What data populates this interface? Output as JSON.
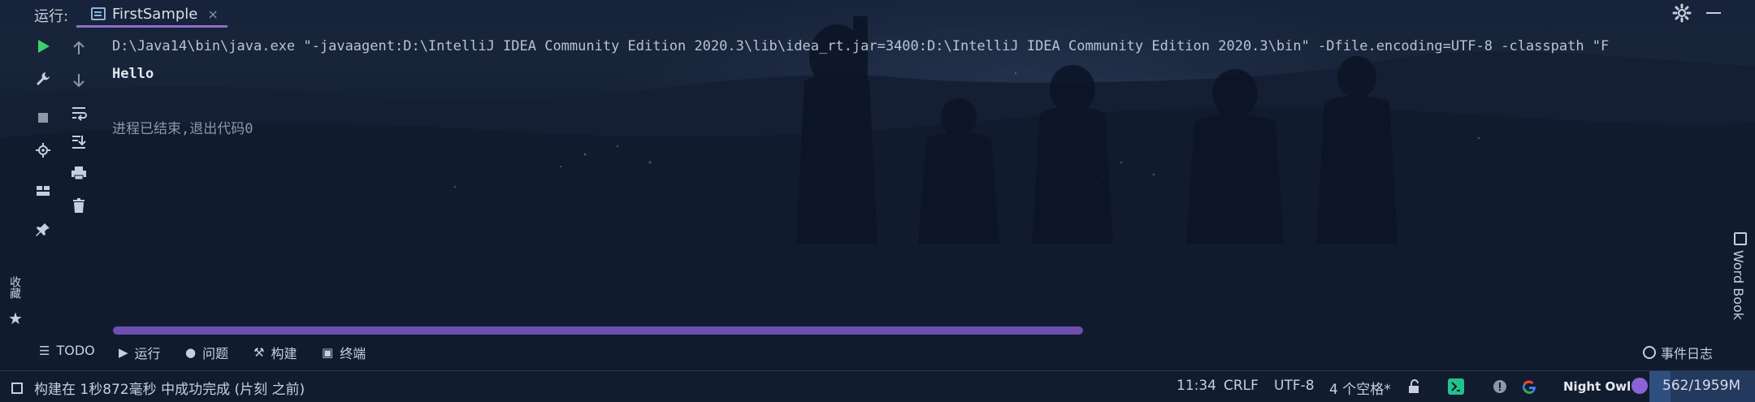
{
  "run_label": "运行:",
  "tab": {
    "title": "FirstSample",
    "close": "×"
  },
  "console": {
    "command": "D:\\Java14\\bin\\java.exe \"-javaagent:D:\\IntelliJ IDEA Community Edition 2020.3\\lib\\idea_rt.jar=3400:D:\\IntelliJ IDEA Community Edition 2020.3\\bin\" -Dfile.encoding=UTF-8 -classpath \"F",
    "output": "Hello",
    "exit": "进程已结束,退出代码0"
  },
  "left_toolbar": [
    "run-icon",
    "wrench-icon",
    "stop-icon",
    "debug-settings-icon",
    "layout-icon",
    "pin-icon"
  ],
  "right_toolbar": [
    "arrow-up-icon",
    "arrow-down-icon",
    "soft-wrap-icon",
    "scroll-to-end-icon",
    "print-icon",
    "trash-icon"
  ],
  "favorites_label": "收藏",
  "word_book_label": "Word Book",
  "tool_windows": {
    "todo": "TODO",
    "run": "运行",
    "problems": "问题",
    "build": "构建",
    "terminal": "终端",
    "event_log": "事件日志"
  },
  "status": {
    "message": "构建在 1秒872毫秒 中成功完成 (片刻 之前)",
    "position": "11:34",
    "line_ending": "CRLF",
    "encoding": "UTF-8",
    "indent": "4 个空格*",
    "theme": "Night Owl",
    "memory": "562/1959M"
  },
  "colors": {
    "accent": "#8b6fc9",
    "run_green": "#3dd16b",
    "scrollbar": "#6e4fb0",
    "plugin_green": "#21c28b",
    "google_blue": "#4285f4",
    "theme_dot": "#8a63d6"
  }
}
